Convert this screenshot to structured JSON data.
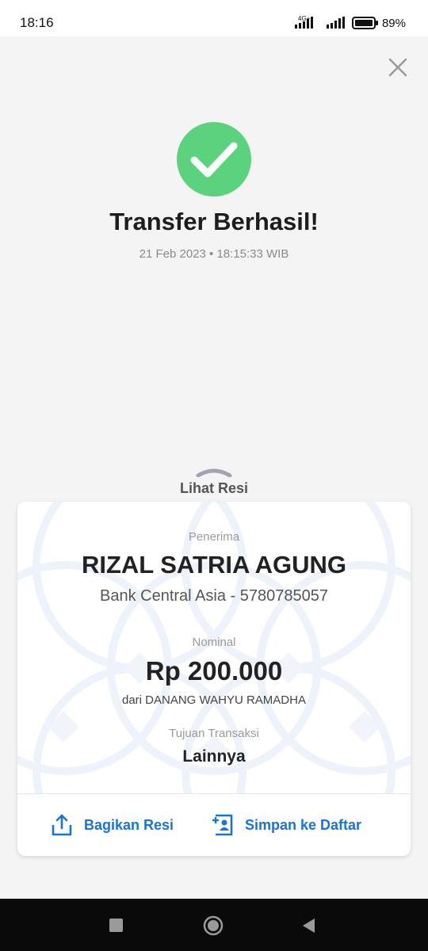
{
  "status_bar": {
    "time": "18:16",
    "network": "4G+",
    "battery": "89%"
  },
  "header": {
    "title": "Transfer Berhasil!",
    "datetime": "21 Feb 2023 • 18:15:33 WIB"
  },
  "receipt_toggle": {
    "label": "Lihat Resi"
  },
  "receipt": {
    "recipient_label": "Penerima",
    "recipient_name": "RIZAL SATRIA AGUNG",
    "recipient_bank": "Bank Central Asia - 5780785057",
    "amount_label": "Nominal",
    "amount": "Rp 200.000",
    "sender": "dari DANANG WAHYU RAMADHA",
    "purpose_label": "Tujuan Transaksi",
    "purpose": "Lainnya"
  },
  "actions": {
    "share_label": "Bagikan Resi",
    "save_label": "Simpan ke Daftar"
  },
  "icons": {
    "close": "close-icon",
    "success": "check-circle-icon",
    "share": "share-icon",
    "save": "add-contact-icon",
    "nav_recent": "square-icon",
    "nav_home": "circle-icon",
    "nav_back": "triangle-back-icon"
  },
  "colors": {
    "success": "#5bd27e",
    "accent": "#1a73d9",
    "background": "#f4f4f4"
  }
}
